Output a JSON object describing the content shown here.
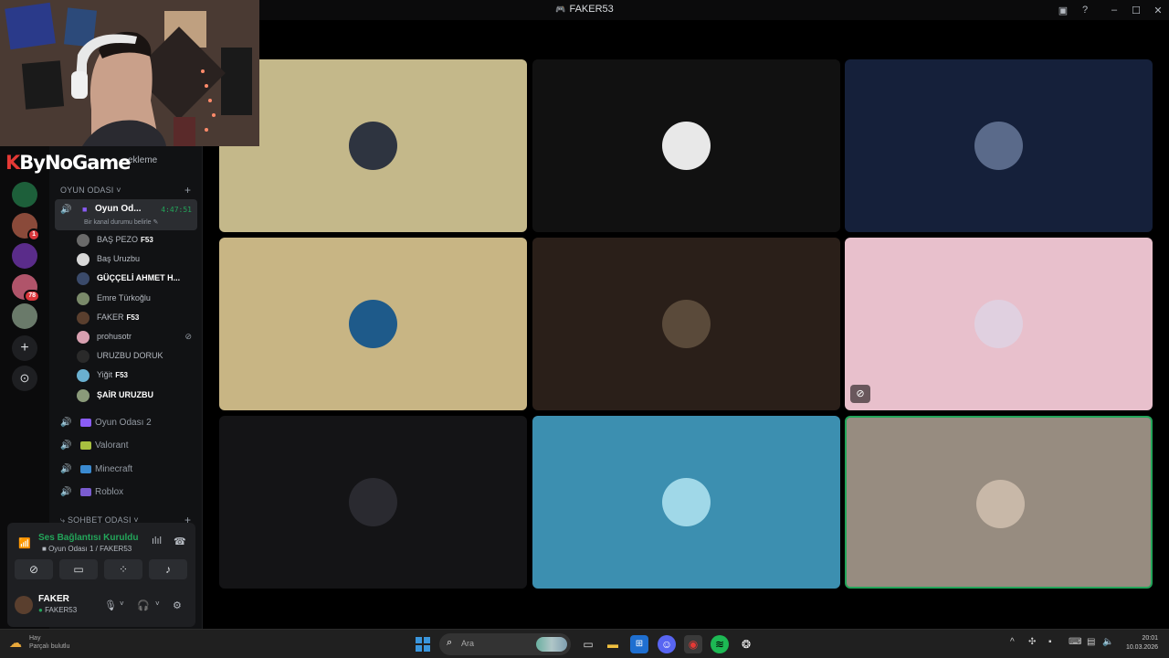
{
  "window": {
    "title": "FAKER53",
    "controls": [
      "inbox-icon",
      "help-icon",
      "minimize-icon",
      "maximize-icon",
      "close-icon"
    ]
  },
  "overlay": {
    "logo_text": "ByNoGame",
    "logo_k": "K"
  },
  "server": {
    "name_partial": "ekleme"
  },
  "servers": [
    {
      "name": "server-1",
      "color": "#1d5f3a"
    },
    {
      "name": "server-2",
      "color": "#8a4a3a",
      "badge": "1"
    },
    {
      "name": "server-3",
      "color": "#5a2c8a"
    },
    {
      "name": "server-4",
      "color": "#b0546a",
      "badge": "78"
    },
    {
      "name": "server-5",
      "color": "#6a7a6a"
    }
  ],
  "categories": {
    "voice": "OYUN ODASI",
    "text": "SOHBET ODASI"
  },
  "active_channel": {
    "name": "Oyun Od...",
    "timer": "4:47:51",
    "status_hint": "Bir kanal durumu belirle"
  },
  "members": [
    {
      "name": "BAŞ PEZO",
      "tag": "F53",
      "color": "#6a6a6a"
    },
    {
      "name": "Baş Uruzbu",
      "tag": "",
      "color": "#d8d8d8"
    },
    {
      "name": "ǤÜÇÇELİ AHMET H...",
      "tag": "",
      "color": "#3a4a6a",
      "bold": true
    },
    {
      "name": "Emre Türkoğlu",
      "tag": "",
      "color": "#7a8a6a"
    },
    {
      "name": "FAKER",
      "tag": "F53",
      "color": "#5a3f2e"
    },
    {
      "name": "prohusotr",
      "tag": "",
      "color": "#d8a0b0",
      "muted": true
    },
    {
      "name": "URUZBU DORUK",
      "tag": "",
      "color": "#2a2a2a"
    },
    {
      "name": "Yiğit",
      "tag": "F53",
      "color": "#6ab0d0"
    },
    {
      "name": "ŞAİR URUZBU",
      "tag": "",
      "color": "#8a9a7a",
      "bold": true
    }
  ],
  "channels": [
    {
      "name": "Oyun Odası 2",
      "icon_color": "#8a5cf5"
    },
    {
      "name": "Valorant",
      "icon_color": "#a8c040"
    },
    {
      "name": "Minecraft",
      "icon_color": "#3a8ad0"
    },
    {
      "name": "Roblox",
      "icon_color": "#7a5cd0"
    }
  ],
  "voice_status": {
    "title": "Ses Bağlantısı Kuruldu",
    "subtitle": "Oyun Odası 1 / FAKER53"
  },
  "user": {
    "name": "FAKER",
    "status": "FAKER53"
  },
  "tiles": [
    {
      "name": "tile-1",
      "bg": "#c4b88a",
      "avatar": "#2e3440"
    },
    {
      "name": "tile-2",
      "bg": "#111111",
      "avatar": "#e8e8e8"
    },
    {
      "name": "tile-3",
      "bg": "#15203a",
      "avatar": "#5a6a8a"
    },
    {
      "name": "tile-4",
      "bg": "#c8b584",
      "avatar": "#1e5a8a"
    },
    {
      "name": "tile-5",
      "bg": "#2a1f19",
      "avatar": "#5a4a3a"
    },
    {
      "name": "tile-6",
      "bg": "#e8c0cc",
      "avatar": "#e0d0e0",
      "muted": true
    },
    {
      "name": "tile-7",
      "bg": "#141416",
      "avatar": "#2a2a30"
    },
    {
      "name": "tile-8",
      "bg": "#3c8fb0",
      "avatar": "#a0d8e8"
    },
    {
      "name": "tile-9",
      "bg": "#978c80",
      "avatar": "#c8b8a8",
      "speaking": true
    }
  ],
  "taskbar": {
    "search_placeholder": "Ara",
    "weather_line1": "Hay",
    "weather_line2": "Parçalı bulutlu",
    "time": "20:01",
    "date": "10.03.2026"
  }
}
